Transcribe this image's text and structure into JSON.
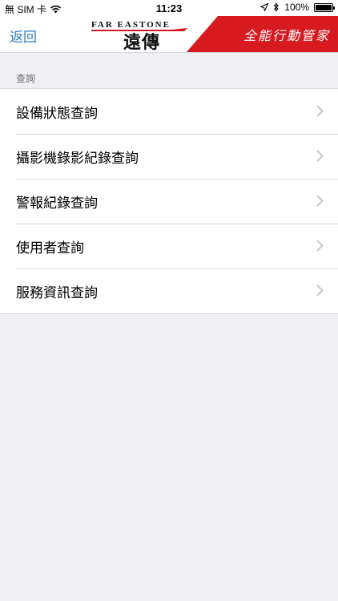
{
  "status_bar": {
    "carrier": "無 SIM 卡",
    "time": "11:23",
    "battery": "100%"
  },
  "nav": {
    "back_label": "返回",
    "brand_wordmark": "FAR EASTONE",
    "brand_chinese": "遠傳",
    "banner_text": "全能行動管家",
    "accent_color": "#2f7cc2",
    "banner_color": "#d71920"
  },
  "section": {
    "header": "查詢",
    "items": [
      {
        "label": "設備狀態查詢"
      },
      {
        "label": "攝影機錄影紀錄查詢"
      },
      {
        "label": "警報紀錄查詢"
      },
      {
        "label": "使用者查詢"
      },
      {
        "label": "服務資訊查詢"
      }
    ]
  },
  "icons": {
    "wifi": "wifi-icon",
    "location": "location-arrow-icon",
    "bluetooth": "bluetooth-icon",
    "battery": "battery-icon",
    "chevron": "chevron-right-icon"
  }
}
